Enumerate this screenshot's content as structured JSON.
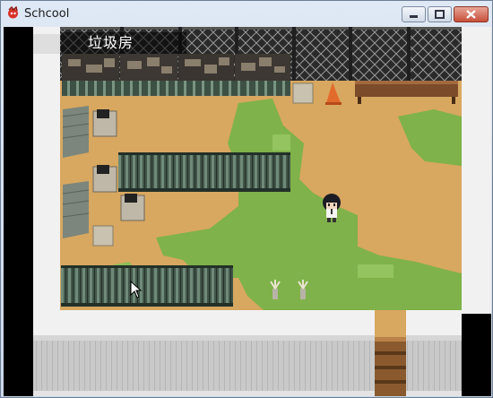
{
  "window": {
    "title": "Schcool",
    "controls": {
      "minimize": "minimize",
      "maximize": "maximize",
      "close": "close"
    }
  },
  "game": {
    "map_name": "垃圾房"
  },
  "colors": {
    "ground": "#d8a760",
    "grass": "#7fb24a",
    "wall": "#f1f1f1",
    "fence": "#2e3f33",
    "void": "#000000"
  }
}
